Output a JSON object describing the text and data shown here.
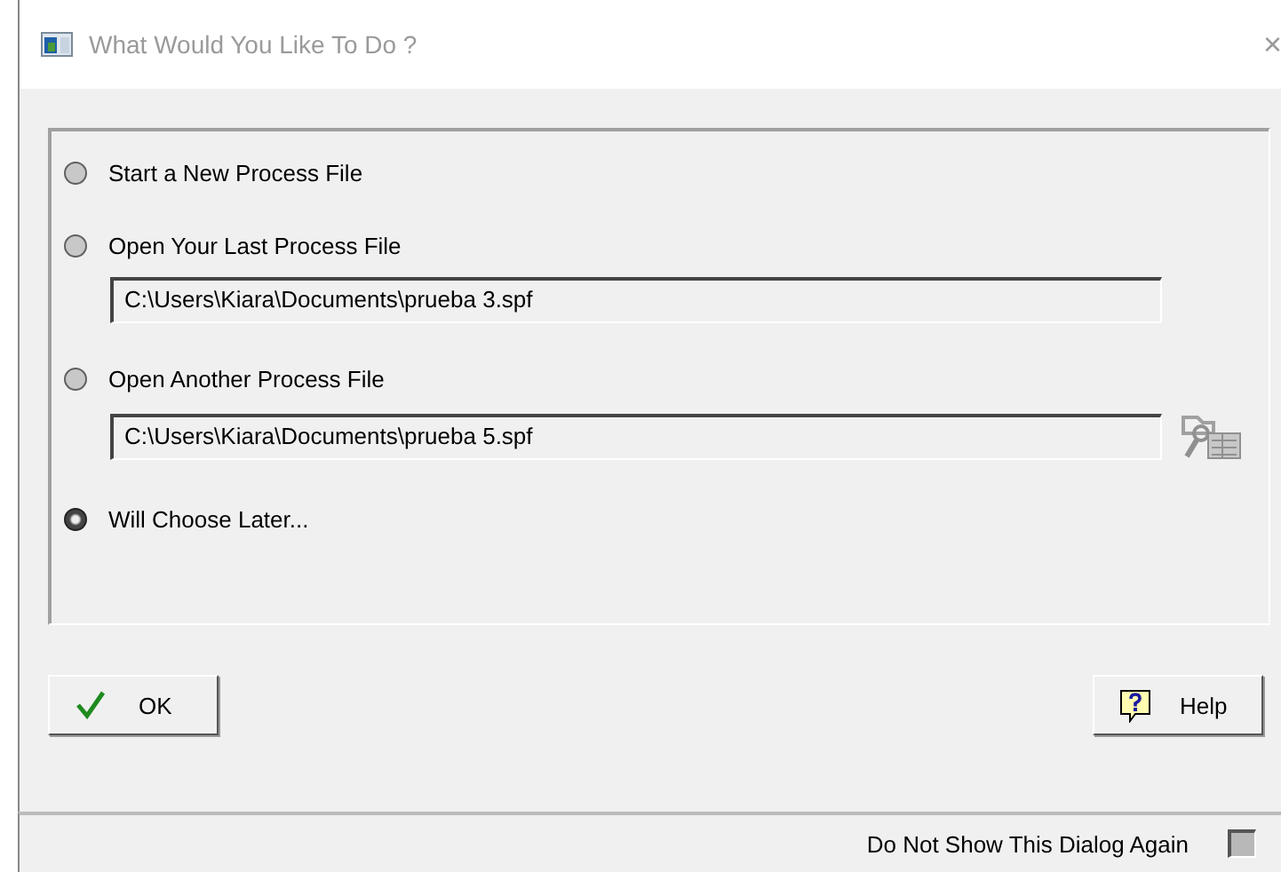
{
  "window": {
    "title": "What Would You Like To Do ?",
    "close": "×"
  },
  "options": [
    {
      "label": "Start a New Process File",
      "selected": false
    },
    {
      "label": "Open Your Last Process File",
      "selected": false,
      "path": "C:\\Users\\Kiara\\Documents\\prueba 3.spf"
    },
    {
      "label": "Open Another Process File",
      "selected": false,
      "path": "C:\\Users\\Kiara\\Documents\\prueba 5.spf",
      "browse": true
    },
    {
      "label": "Will Choose Later...",
      "selected": true
    }
  ],
  "buttons": [
    {
      "kind": "ok",
      "label": "OK"
    },
    {
      "kind": "help",
      "label": "Help"
    }
  ],
  "dont_show_again": {
    "label": "Do Not Show This Dialog Again",
    "checked": false
  }
}
